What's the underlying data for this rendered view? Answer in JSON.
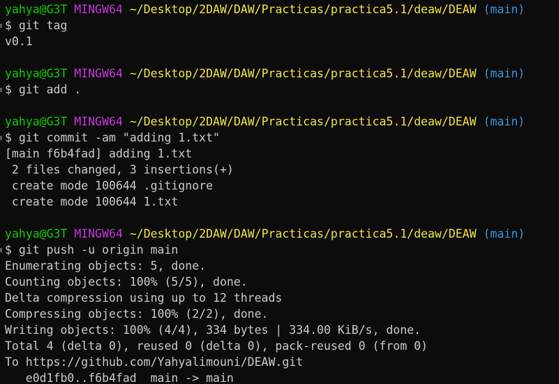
{
  "colors": {
    "background": "#0c0c0c",
    "user_host": "#16c60c",
    "system": "#c239d8",
    "path": "#f2e44a",
    "branch": "#3a96dd",
    "text": "#cccccc"
  },
  "prompt": {
    "user_host": "yahya@G3T",
    "system": "MINGW64",
    "path": "~/Desktop/2DAW/DAW/Practicas/practica5.1/deaw/DEAW",
    "branch": "(main)",
    "sigil": "$"
  },
  "blocks": [
    {
      "command": "git tag",
      "output": [
        "v0.1"
      ]
    },
    {
      "command": "git add .",
      "output": []
    },
    {
      "command": "git commit -am \"adding 1.txt\"",
      "output": [
        "[main f6b4fad] adding 1.txt",
        " 2 files changed, 3 insertions(+)",
        " create mode 100644 .gitignore",
        " create mode 100644 1.txt"
      ]
    },
    {
      "command": "git push -u origin main",
      "output": [
        "Enumerating objects: 5, done.",
        "Counting objects: 100% (5/5), done.",
        "Delta compression using up to 12 threads",
        "Compressing objects: 100% (2/2), done.",
        "Writing objects: 100% (4/4), 334 bytes | 334.00 KiB/s, done.",
        "Total 4 (delta 0), reused 0 (delta 0), pack-reused 0 (from 0)",
        "To https://github.com/Yahyalimouni/DEAW.git",
        "   e0d1fb0..f6b4fad  main -> main"
      ]
    }
  ]
}
